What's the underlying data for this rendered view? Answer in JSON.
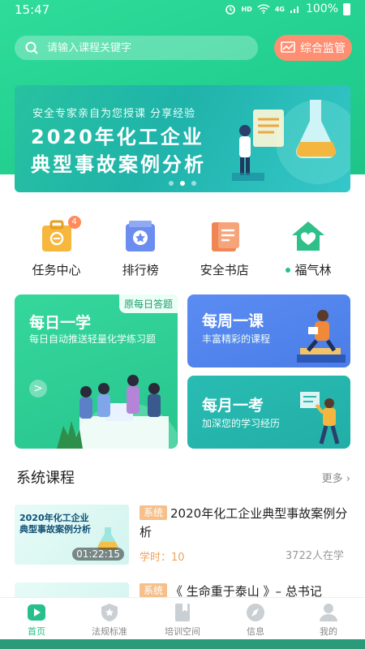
{
  "status": {
    "time": "15:47",
    "hd": "HD",
    "net": "4G",
    "battery": "100%"
  },
  "search": {
    "placeholder": "请输入课程关键字"
  },
  "monitor": {
    "label": "综合监管"
  },
  "banner": {
    "subtitle": "安全专家亲自为您授课 分享经验",
    "line1": "2020年化工企业",
    "line2": "典型事故案例分析",
    "dots": 3,
    "active_dot": 2
  },
  "quick": [
    {
      "label": "任务中心",
      "badge": "4",
      "icon": "task-bag-icon"
    },
    {
      "label": "排行榜",
      "icon": "ranking-icon"
    },
    {
      "label": "安全书店",
      "icon": "book-store-icon"
    },
    {
      "label": "福气林",
      "icon": "house-heart-icon"
    }
  ],
  "cards": {
    "daily": {
      "tag": "原每日答题",
      "title": "每日一学",
      "desc": "每日自动推送轻量化学练习题",
      "go": ">"
    },
    "weekly": {
      "title": "每周一课",
      "desc": "丰富精彩的课程"
    },
    "monthly": {
      "title": "每月一考",
      "desc": "加深您的学习经历"
    }
  },
  "section": {
    "title": "系统课程",
    "more": "更多"
  },
  "courses": [
    {
      "thumb_line1": "2020年化工企业",
      "thumb_line2": "典型事故案例分析",
      "duration": "01:22:15",
      "tag": "系统",
      "name": "2020年化工企业典型事故案例分析",
      "hours": "学时：10",
      "count": "3722人在学"
    },
    {
      "tag": "系统",
      "name": "《 生命重于泰山 》– 总书记"
    }
  ],
  "tabs": [
    {
      "label": "首页",
      "icon": "home-play-icon",
      "active": true
    },
    {
      "label": "法规标准",
      "icon": "regulation-shield-icon"
    },
    {
      "label": "培训空间",
      "icon": "training-bookmark-icon"
    },
    {
      "label": "信息",
      "icon": "compass-icon"
    },
    {
      "label": "我的",
      "icon": "user-icon"
    }
  ],
  "colors": {
    "primary": "#27c08c",
    "accent": "#ff8f72",
    "weekly": "#5a8cf2",
    "monthly": "#29bcb3",
    "tag": "#f7c08a"
  }
}
